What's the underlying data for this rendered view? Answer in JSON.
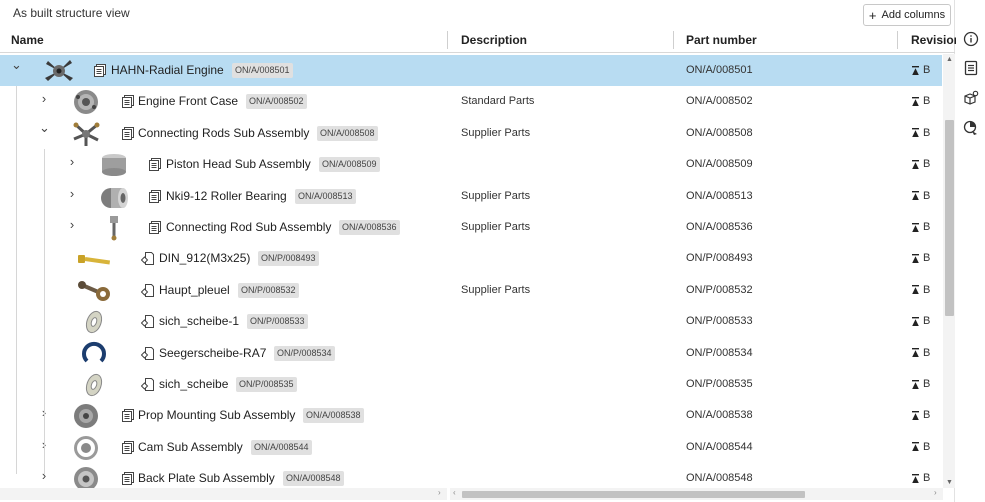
{
  "view_title": "As built structure view",
  "add_columns_label": "Add columns",
  "columns": {
    "name": "Name",
    "description": "Description",
    "part_number": "Part number",
    "revision": "Revision"
  },
  "rows": [
    {
      "name": "HAHN-Radial Engine",
      "tag": "ON/A/008501",
      "description": "",
      "part_number": "ON/A/008501",
      "revision": "B",
      "level": 0,
      "expander": "expanded",
      "type": "assembly",
      "thumb": "engine",
      "selected": true
    },
    {
      "name": "Engine Front Case",
      "tag": "ON/A/008502",
      "description": "Standard Parts",
      "part_number": "ON/A/008502",
      "revision": "B",
      "level": 1,
      "expander": "collapsed",
      "type": "assembly",
      "thumb": "case"
    },
    {
      "name": "Connecting Rods Sub Assembly",
      "tag": "ON/A/008508",
      "description": "Supplier Parts",
      "part_number": "ON/A/008508",
      "revision": "B",
      "level": 1,
      "expander": "expanded",
      "type": "assembly",
      "thumb": "rods"
    },
    {
      "name": "Piston Head Sub Assembly",
      "tag": "ON/A/008509",
      "description": "",
      "part_number": "ON/A/008509",
      "revision": "B",
      "level": 2,
      "expander": "collapsed",
      "type": "assembly",
      "thumb": "piston"
    },
    {
      "name": "Nki9-12 Roller Bearing",
      "tag": "ON/A/008513",
      "description": "Supplier Parts",
      "part_number": "ON/A/008513",
      "revision": "B",
      "level": 2,
      "expander": "collapsed",
      "type": "assembly",
      "thumb": "bearing"
    },
    {
      "name": "Connecting Rod Sub Assembly",
      "tag": "ON/A/008536",
      "description": "Supplier Parts",
      "part_number": "ON/A/008536",
      "revision": "B",
      "level": 2,
      "expander": "collapsed",
      "type": "assembly",
      "thumb": "rod"
    },
    {
      "name": "DIN_912(M3x25)",
      "tag": "ON/P/008493",
      "description": "",
      "part_number": "ON/P/008493",
      "revision": "B",
      "level": 2,
      "expander": "none",
      "type": "part",
      "thumb": "bolt"
    },
    {
      "name": "Haupt_pleuel",
      "tag": "ON/P/008532",
      "description": "Supplier Parts",
      "part_number": "ON/P/008532",
      "revision": "B",
      "level": 2,
      "expander": "none",
      "type": "part",
      "thumb": "pleuel"
    },
    {
      "name": "sich_scheibe-1",
      "tag": "ON/P/008533",
      "description": "",
      "part_number": "ON/P/008533",
      "revision": "B",
      "level": 2,
      "expander": "none",
      "type": "part",
      "thumb": "washer"
    },
    {
      "name": "Seegerscheibe-RA7",
      "tag": "ON/P/008534",
      "description": "",
      "part_number": "ON/P/008534",
      "revision": "B",
      "level": 2,
      "expander": "none",
      "type": "part",
      "thumb": "circlip"
    },
    {
      "name": "sich_scheibe",
      "tag": "ON/P/008535",
      "description": "",
      "part_number": "ON/P/008535",
      "revision": "B",
      "level": 2,
      "expander": "none",
      "type": "part",
      "thumb": "washer"
    },
    {
      "name": "Prop Mounting Sub Assembly",
      "tag": "ON/A/008538",
      "description": "",
      "part_number": "ON/A/008538",
      "revision": "B",
      "level": 1,
      "expander": "collapsed",
      "type": "assembly",
      "thumb": "prop"
    },
    {
      "name": "Cam Sub Assembly",
      "tag": "ON/A/008544",
      "description": "",
      "part_number": "ON/A/008544",
      "revision": "B",
      "level": 1,
      "expander": "collapsed",
      "type": "assembly",
      "thumb": "cam"
    },
    {
      "name": "Back Plate Sub Assembly",
      "tag": "ON/A/008548",
      "description": "",
      "part_number": "ON/A/008548",
      "revision": "B",
      "level": 1,
      "expander": "collapsed",
      "type": "assembly",
      "thumb": "plate"
    }
  ],
  "right_toolbar": [
    {
      "icon": "info-icon"
    },
    {
      "icon": "document-icon"
    },
    {
      "icon": "configure-parts-icon"
    },
    {
      "icon": "appearance-icon"
    }
  ],
  "colors": {
    "selected_row": "#b8dcf2",
    "tag_bg": "#e0e0e0",
    "scroll_thumb": "#c2c2c2"
  }
}
